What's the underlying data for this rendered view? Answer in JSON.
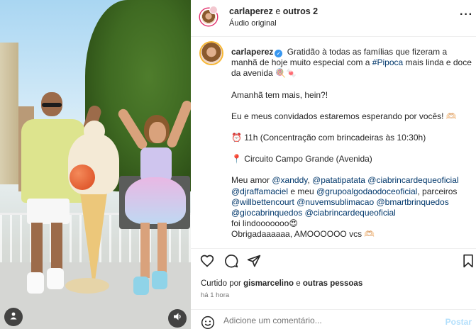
{
  "header": {
    "account": "carlaperez",
    "connector": "e",
    "others": "outros 2",
    "audio": "Áudio original"
  },
  "caption": {
    "username": "carlaperez",
    "line1_text": "Gratidão à todas as famílias que fizeram a manhã de hoje muito especial com a",
    "hashtag": "#Pipoca",
    "line1_end": "mais linda e doce da avenida 🍭🍬",
    "line2": "Amanhã tem mais, hein?!",
    "line3": "Eu e meus convidados estaremos esperando por vocês! 🫶🏻",
    "time_line": "⏰ 11h (Concentração com brincadeiras às 10:30h)",
    "place_line": "📍 Circuito Campo Grande (Avenida)",
    "thanks_prefix": "Meu amor",
    "mention1": "@xanddy",
    "mention2": "@patatipatata",
    "mention3": "@ciabrincardequeoficial",
    "mention4": "@djraffamaciel",
    "and_my": "e meu",
    "mention5": "@grupoalgodaodoceoficial",
    "partners": "parceiros",
    "mention6": "@willbettencourt",
    "mention7": "@nuvemsublimacao",
    "mention8": "@bmartbrinquedos",
    "mention9": "@giocabrinquedos",
    "mention10": "@ciabrincardequeoficial",
    "lindo": "foi lindooooooo😍",
    "obrigada": "Obrigadaaaaaa, AMOOOOOO vcs 🫶🏻"
  },
  "likes": {
    "prefix": "Curtido por",
    "user": "gismarcelino",
    "connector": "e",
    "others": "outras pessoas"
  },
  "time_ago": "há 1 hora",
  "add_comment": {
    "placeholder": "Adicione um comentário...",
    "post_label": "Postar"
  },
  "icons": {
    "like": "heart-icon",
    "comment": "comment-icon",
    "share": "share-icon",
    "save": "bookmark-icon",
    "more": "more-icon",
    "emoji": "smile-icon",
    "user": "user-icon",
    "mute": "speaker-icon",
    "verified": "verified-badge-icon"
  },
  "colors": {
    "link": "#00376b",
    "verified": "#3897f0",
    "post_disabled": "#b2dffc",
    "story_ring": "#e1306c"
  }
}
